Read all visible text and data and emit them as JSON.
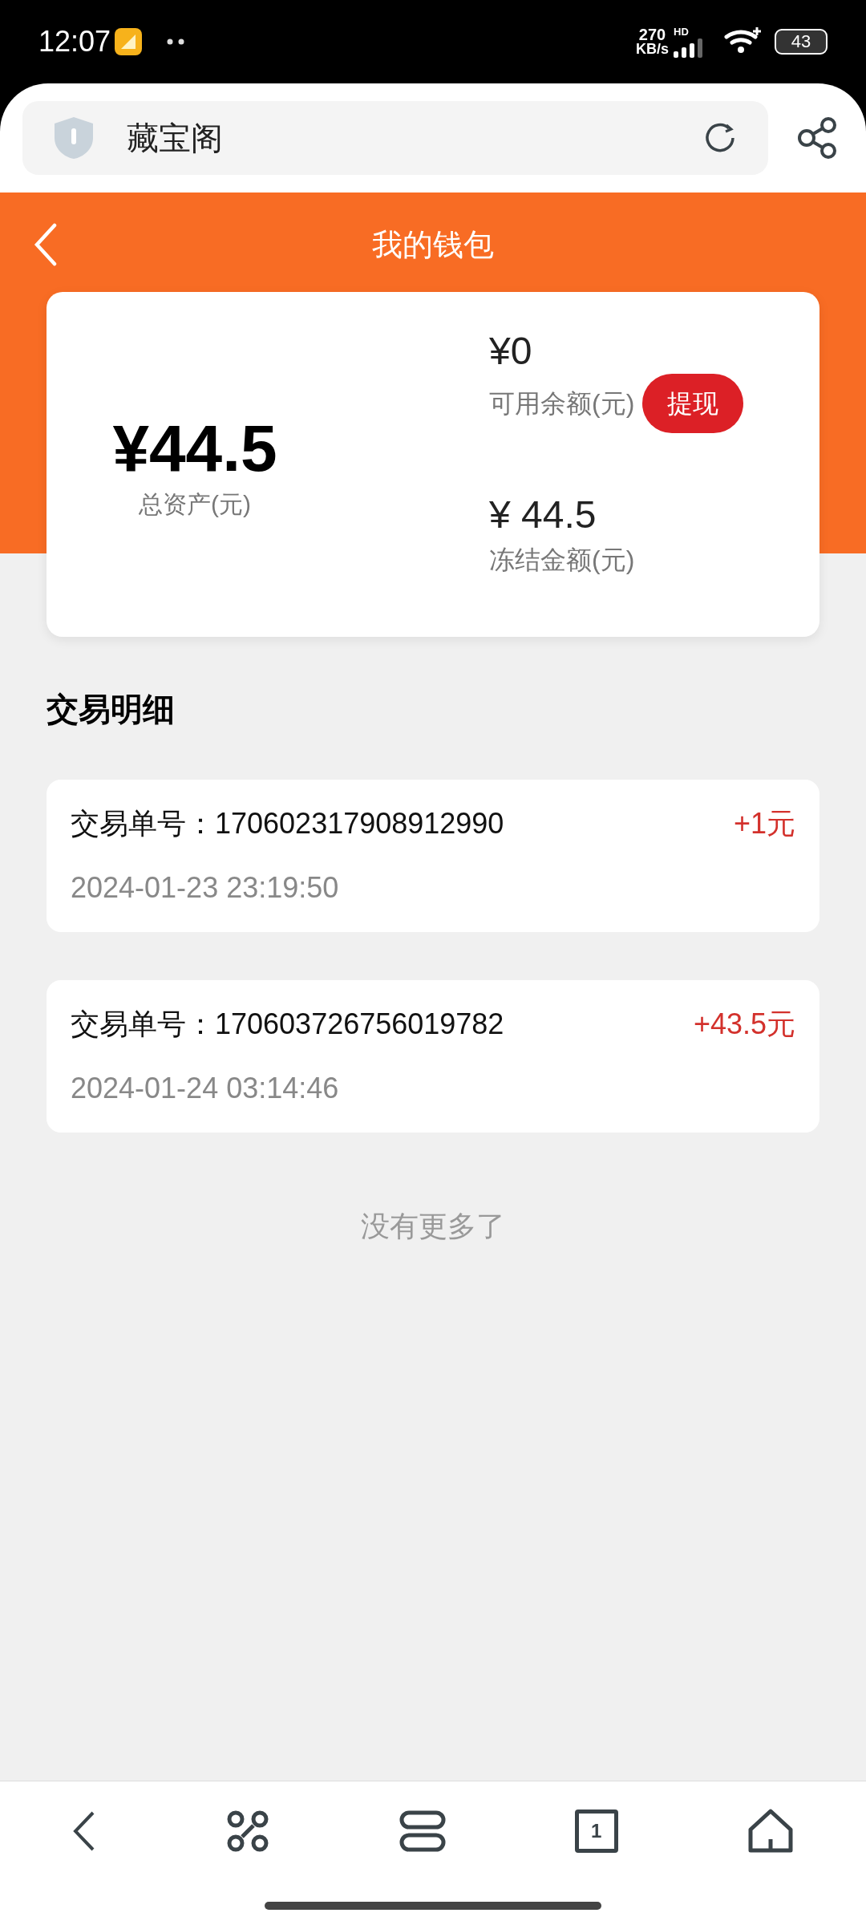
{
  "status_bar": {
    "time": "12:07",
    "net_speed": "270",
    "net_unit": "KB/s",
    "signal_label": "HD",
    "battery": "43"
  },
  "browser": {
    "address": "藏宝阁",
    "tab_count": "1"
  },
  "page": {
    "title": "我的钱包"
  },
  "wallet": {
    "total_amount": "¥44.5",
    "total_label": "总资产(元)",
    "available_amount": "¥0",
    "available_label": "可用余额(元)",
    "withdraw_button": "提现",
    "frozen_amount": "¥ 44.5",
    "frozen_label": "冻结金额(元)"
  },
  "transactions": {
    "heading": "交易明细",
    "items": [
      {
        "number": "交易单号：170602317908912990",
        "amount": "+1元",
        "time": "2024-01-23 23:19:50"
      },
      {
        "number": "交易单号：170603726756019782",
        "amount": "+43.5元",
        "time": "2024-01-24 03:14:46"
      }
    ],
    "end_note": "没有更多了"
  }
}
